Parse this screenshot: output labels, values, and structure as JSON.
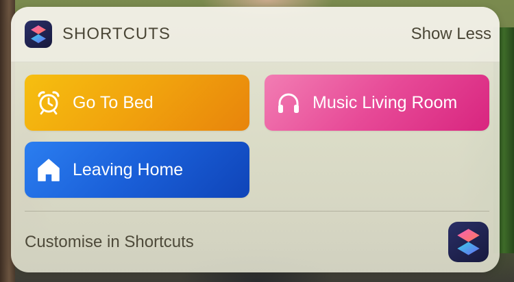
{
  "widget": {
    "header": {
      "app_icon": "shortcuts-app-icon",
      "title": "SHORTCUTS",
      "show_less_label": "Show Less"
    },
    "shortcuts": [
      {
        "label": "Go To Bed",
        "icon": "alarm-clock-icon",
        "color": "#f1a30d"
      },
      {
        "label": "Music Living Room",
        "icon": "headphones-icon",
        "color": "#e74a97"
      },
      {
        "label": "Leaving Home",
        "icon": "house-icon",
        "color": "#1a5fd8"
      }
    ],
    "footer": {
      "customise_label": "Customise in Shortcuts",
      "app_icon": "shortcuts-app-icon"
    }
  }
}
